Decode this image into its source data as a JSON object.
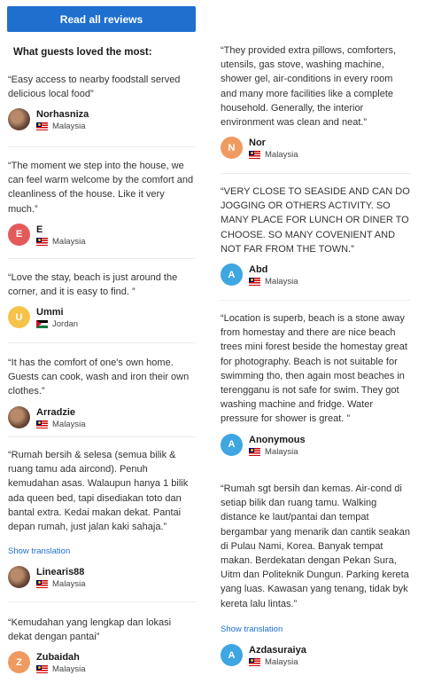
{
  "header": {
    "read_all_label": "Read all reviews"
  },
  "section_title": "What guests loved the most:",
  "show_translation_label": "Show translation",
  "left_reviews": [
    {
      "quote": "“Easy access to nearby foodstall served delicious local food”",
      "name": "Norhasniza",
      "country": "Malaysia",
      "avatar_initial": "",
      "avatar_type": "photo"
    },
    {
      "quote": "“The moment we step into the house, we can feel warm welcome by the comfort and cleanliness of the house. Like it very much.”",
      "name": "E",
      "country": "Malaysia",
      "avatar_initial": "E",
      "avatar_color": "#e35a5a"
    },
    {
      "quote": "“Love the stay, beach is just around the corner, and it is easy to find. ”",
      "name": "Ummi",
      "country": "Jordan",
      "avatar_initial": "U",
      "avatar_color": "#f5c34a"
    },
    {
      "quote": "“It has the comfort of one's own home. Guests can cook, wash and iron their own clothes.”",
      "name": "Arradzie",
      "country": "Malaysia",
      "avatar_initial": "",
      "avatar_type": "photo"
    },
    {
      "quote": "“Rumah bersih & selesa (semua bilik & ruang tamu ada aircond). Penuh kemudahan asas. Walaupun hanya 1 bilik ada queen bed, tapi disediakan toto dan bantal extra. Kedai makan dekat. Pantai depan rumah, just jalan kaki sahaja.”",
      "name": "Linearis88",
      "country": "Malaysia",
      "avatar_initial": "",
      "avatar_type": "photo"
    },
    {
      "quote": "“Kemudahan yang lengkap dan lokasi dekat dengan pantai”",
      "name": "Zubaidah",
      "country": "Malaysia",
      "avatar_initial": "Z",
      "avatar_color": "#ef9a60"
    }
  ],
  "right_reviews": [
    {
      "quote": "“They provided extra pillows, comforters, utensils, gas stove, washing machine, shower gel, air-conditions in every room and many more facilities like a complete household. Generally, the interior environment was clean and neat.”",
      "name": "Nor",
      "country": "Malaysia",
      "avatar_initial": "N",
      "avatar_color": "#ef9a60"
    },
    {
      "quote": "“VERY CLOSE TO SEASIDE AND CAN DO JOGGING OR OTHERS ACTIVITY. SO MANY PLACE FOR LUNCH OR DINER TO CHOOSE. SO MANY COVENIENT AND NOT FAR FROM THE TOWN.”",
      "name": "Abd",
      "country": "Malaysia",
      "avatar_initial": "A",
      "avatar_color": "#3ea6e0"
    },
    {
      "quote": "“Location is superb, beach is a stone away from homestay and there are nice beach trees mini forest beside the homestay great for photography. Beach is not suitable for swimming tho, then again most beaches in terengganu is not safe for swim. They got washing machine and fridge. Water pressure for shower is great. ”",
      "name": "Anonymous",
      "country": "Malaysia",
      "avatar_initial": "A",
      "avatar_color": "#3ea6e0"
    },
    {
      "quote": "“Rumah sgt bersih dan kemas. Air-cond di setiap bilik dan ruang tamu. Walking distance ke laut/pantai dan tempat bergambar yang menarik dan cantik seakan di Pulau Nami, Korea. Banyak tempat makan. Berdekatan dengan Pekan Sura, Uitm dan Politeknik Dungun. Parking kereta yang luas. Kawasan yang tenang, tidak byk kereta lalu lintas.”",
      "name": "Azdasuraiya",
      "country": "Malaysia",
      "avatar_initial": "A",
      "avatar_color": "#3ea6e0"
    }
  ]
}
